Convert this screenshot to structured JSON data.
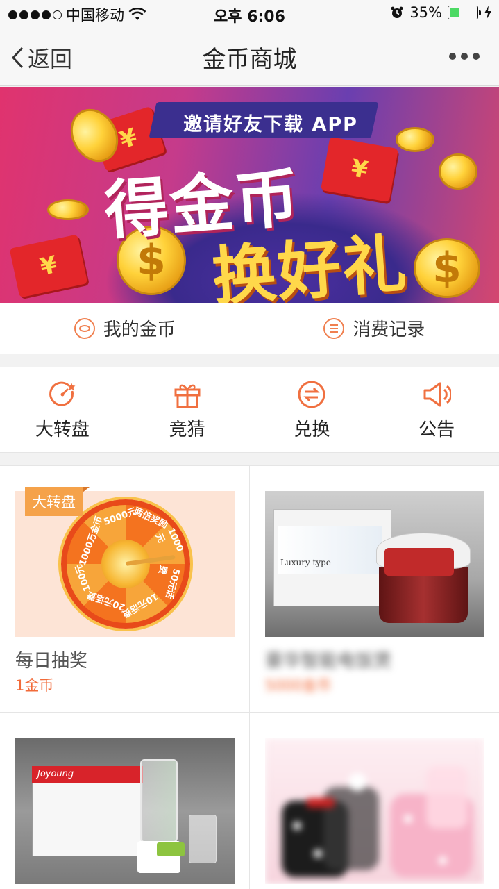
{
  "status_bar": {
    "carrier": "中国移动",
    "time": "오후 6:06",
    "battery_percent": "35%",
    "battery_level": 0.35,
    "signal_bars_filled": 4,
    "signal_bars_total": 5
  },
  "nav": {
    "back_label": "返回",
    "title": "金币商城"
  },
  "banner": {
    "ribbon_text": "邀请好友下载 APP",
    "headline_1": "得金币",
    "headline_2": "换好礼",
    "coin_symbol": "$",
    "yuan_symbol": "¥"
  },
  "coin_links": [
    {
      "label": "我的金币",
      "icon": "coin-icon"
    },
    {
      "label": "消费记录",
      "icon": "list-icon"
    }
  ],
  "quick_menu": [
    {
      "label": "大转盘",
      "icon": "wheel-icon"
    },
    {
      "label": "竞猜",
      "icon": "gift-icon"
    },
    {
      "label": "兑换",
      "icon": "exchange-icon"
    },
    {
      "label": "公告",
      "icon": "speaker-icon"
    }
  ],
  "products": [
    {
      "tag": "大转盘",
      "name": "每日抽奖",
      "price": "1金币",
      "wheel_labels": [
        "5000元",
        "两倍奖励",
        "1000元",
        "50元话费",
        "10元话费",
        "20元话费",
        "100元",
        "1000万金币"
      ]
    },
    {
      "name": "豪华智能电饭煲",
      "price": "5000金币",
      "box_text": "Luxury type",
      "blurred": true
    },
    {
      "name": "",
      "price": "",
      "box_brand": "Joyoung"
    },
    {
      "name": "",
      "price": ""
    }
  ],
  "colors": {
    "accent": "#f26b3a",
    "tag": "#f5a24a",
    "icon": "#f08050"
  }
}
